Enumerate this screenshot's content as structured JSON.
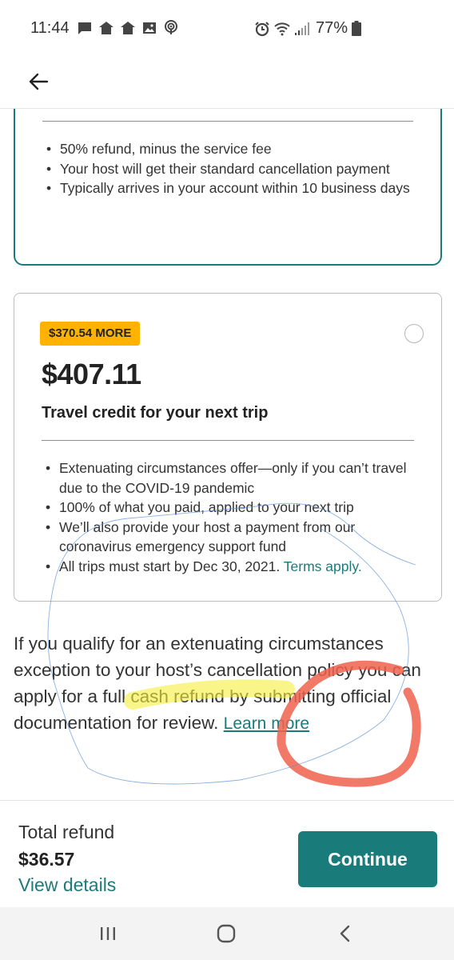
{
  "status_bar": {
    "time": "11:44",
    "battery_percent": "77%",
    "notification_icons": [
      "message-icon",
      "home-icon",
      "home-icon",
      "image-icon",
      "podcast-icon"
    ],
    "system_icons": [
      "alarm-icon",
      "wifi-icon",
      "signal-icon",
      "battery-icon"
    ]
  },
  "nav": {
    "back_icon": "arrow-left-icon"
  },
  "selected_option": {
    "bullets": [
      "50% refund, minus the service fee",
      "Your host will get their standard cancellation payment",
      "Typically arrives in your account within 10 business days"
    ],
    "accent_color": "#1c7a7a"
  },
  "credit_option": {
    "badge": "$370.54 MORE",
    "amount": "$407.11",
    "title": "Travel credit for your next trip",
    "bullets": [
      "Extenuating circumstances offer—only if you can’t travel due to the COVID-19 pandemic",
      "100% of what you paid, applied to your next trip",
      "We’ll also provide your host a payment from our coronavirus emergency support fund",
      "All trips must start by Dec 30, 2021."
    ],
    "terms_link": "Terms apply.",
    "badge_color": "#ffb200"
  },
  "info": {
    "text": "If you qualify for an extenuating circumstances exception to your host’s cancellation policy you can apply for a full cash refund by submitting official documentation for review.",
    "learn_more": "Learn more"
  },
  "footer": {
    "total_label": "Total refund",
    "total_amount": "$36.57",
    "view_details": "View details",
    "continue_label": "Continue",
    "button_color": "#1a7b7b"
  },
  "android_nav": {
    "buttons": [
      "recents-icon",
      "home-icon",
      "back-icon"
    ]
  }
}
